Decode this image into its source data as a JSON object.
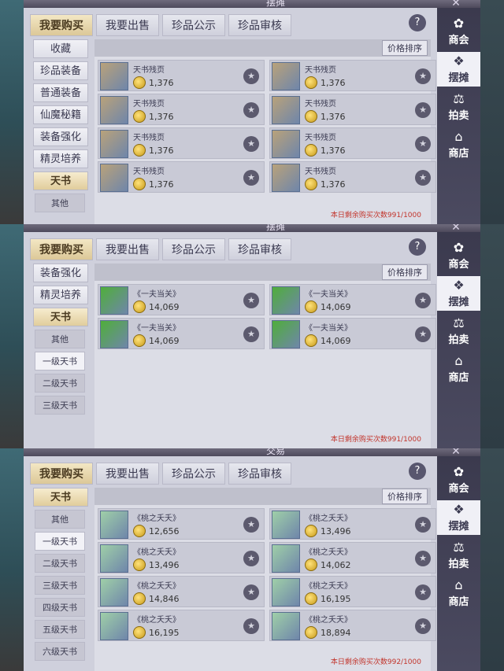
{
  "tabs": [
    "我要购买",
    "我要出售",
    "珍品公示",
    "珍品审核"
  ],
  "help": "?",
  "sort_button": "价格排序",
  "side": [
    {
      "icon": "merchant-icon",
      "label": "商会"
    },
    {
      "icon": "stall-icon",
      "label": "摆摊"
    },
    {
      "icon": "auction-icon",
      "label": "拍卖"
    },
    {
      "icon": "shop-icon",
      "label": "商店"
    }
  ],
  "panels": [
    {
      "frame_title": "摆摊",
      "categories": [
        {
          "label": "收藏",
          "type": "main"
        },
        {
          "label": "珍品装备",
          "type": "main"
        },
        {
          "label": "普通装备",
          "type": "main"
        },
        {
          "label": "仙魔秘籍",
          "type": "main"
        },
        {
          "label": "装备强化",
          "type": "main"
        },
        {
          "label": "精灵培养",
          "type": "main"
        },
        {
          "label": "天书",
          "type": "active"
        },
        {
          "label": "其他",
          "type": "sub-partial"
        }
      ],
      "items": [
        {
          "name": "天书残页",
          "price": "1,376"
        },
        {
          "name": "天书残页",
          "price": "1,376"
        },
        {
          "name": "天书残页",
          "price": "1,376"
        },
        {
          "name": "天书残页",
          "price": "1,376"
        },
        {
          "name": "天书残页",
          "price": "1,376"
        },
        {
          "name": "天书残页",
          "price": "1,376"
        },
        {
          "name": "天书残页",
          "price": "1,376"
        },
        {
          "name": "天书残页",
          "price": "1,376"
        }
      ],
      "remaining": "本日剩余购买次数991/1000",
      "icon_color": "#b9a27a"
    },
    {
      "frame_title": "摆摊",
      "categories": [
        {
          "label": "装备强化",
          "type": "main"
        },
        {
          "label": "精灵培养",
          "type": "main"
        },
        {
          "label": "天书",
          "type": "active"
        },
        {
          "label": "其他",
          "type": "sub-dark"
        },
        {
          "label": "一级天书",
          "type": "sub-sel"
        },
        {
          "label": "二级天书",
          "type": "sub-dark"
        },
        {
          "label": "三级天书",
          "type": "sub-dark"
        }
      ],
      "items": [
        {
          "name": "《一夫当关》",
          "price": "14,069"
        },
        {
          "name": "《一夫当关》",
          "price": "14,069"
        },
        {
          "name": "《一夫当关》",
          "price": "14,069"
        },
        {
          "name": "《一夫当关》",
          "price": "14,069"
        }
      ],
      "remaining": "本日剩余购买次数991/1000",
      "icon_color": "#4fae3a"
    },
    {
      "frame_title": "交易",
      "categories": [
        {
          "label": "天书",
          "type": "active"
        },
        {
          "label": "其他",
          "type": "sub-dark"
        },
        {
          "label": "一级天书",
          "type": "sub-sel"
        },
        {
          "label": "二级天书",
          "type": "sub-dark"
        },
        {
          "label": "三级天书",
          "type": "sub-dark"
        },
        {
          "label": "四级天书",
          "type": "sub-dark"
        },
        {
          "label": "五级天书",
          "type": "sub-dark"
        },
        {
          "label": "六级天书",
          "type": "sub-dark"
        }
      ],
      "items": [
        {
          "name": "《桃之夭夭》",
          "price": "12,656"
        },
        {
          "name": "《桃之夭夭》",
          "price": "13,496"
        },
        {
          "name": "《桃之夭夭》",
          "price": "13,496"
        },
        {
          "name": "《桃之夭夭》",
          "price": "14,062"
        },
        {
          "name": "《桃之夭夭》",
          "price": "14,846"
        },
        {
          "name": "《桃之夭夭》",
          "price": "16,195"
        },
        {
          "name": "《桃之夭夭》",
          "price": "16,195"
        },
        {
          "name": "《桃之夭夭》",
          "price": "18,894"
        }
      ],
      "remaining": "本日剩余购买次数992/1000",
      "icon_color": "#9fcfa8"
    }
  ]
}
